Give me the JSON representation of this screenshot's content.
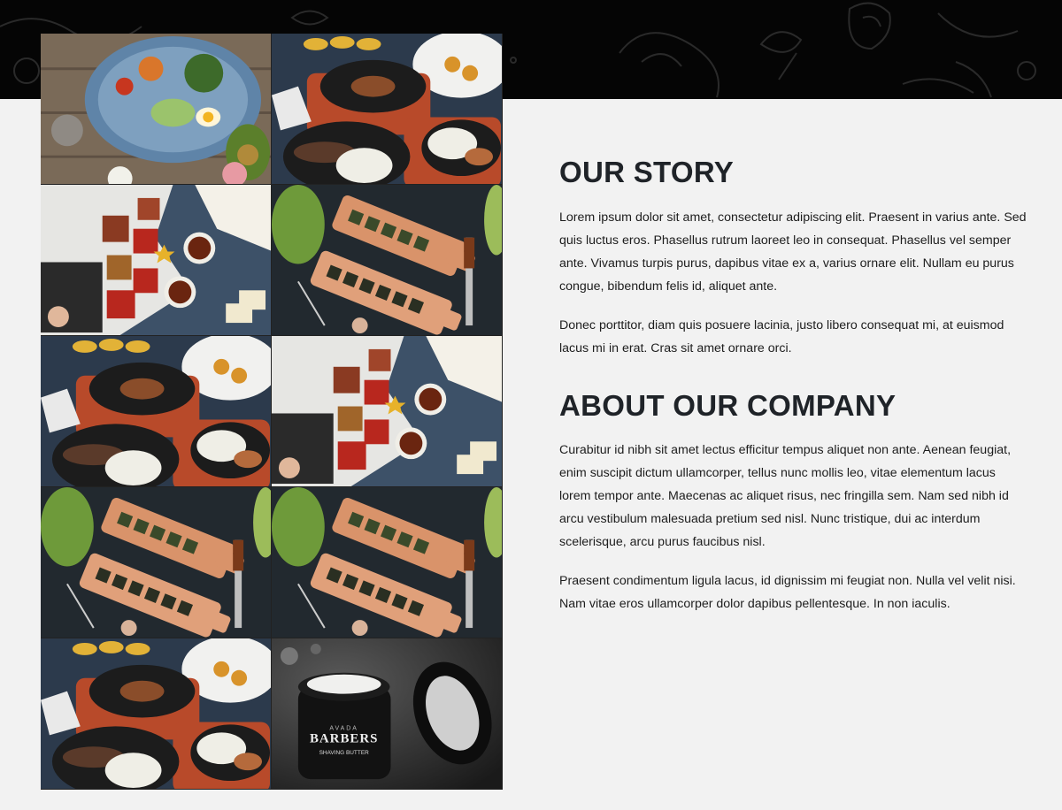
{
  "header": {
    "background_color": "#050505",
    "pattern": "food-doodle-pattern"
  },
  "gallery": {
    "tiles": [
      {
        "subject": "salad-bowl-photo"
      },
      {
        "subject": "sizzling-plates-photo"
      },
      {
        "subject": "breakfast-tea-photo"
      },
      {
        "subject": "sushi-boards-photo"
      },
      {
        "subject": "sizzling-plates-photo"
      },
      {
        "subject": "breakfast-tea-photo"
      },
      {
        "subject": "sushi-boards-photo"
      },
      {
        "subject": "sushi-boards-photo"
      },
      {
        "subject": "sizzling-plates-photo"
      },
      {
        "subject": "shaving-butter-jar-photo"
      }
    ],
    "product_label": {
      "brand_small": "AVADA",
      "brand": "BARBERS",
      "product": "SHAVING BUTTER"
    }
  },
  "story": {
    "title": "OUR STORY",
    "paragraphs": [
      "Lorem ipsum dolor sit amet, consectetur adipiscing elit. Praesent in varius ante. Sed quis luctus eros. Phasellus rutrum laoreet leo in consequat. Phasellus vel semper ante. Vivamus turpis purus, dapibus vitae ex a, varius ornare elit. Nullam eu purus congue, bibendum felis id, aliquet ante.",
      "Donec porttitor, diam quis posuere lacinia, justo libero consequat mi, at euismod lacus mi in erat. Cras sit amet ornare orci."
    ]
  },
  "company": {
    "title": "ABOUT OUR COMPANY",
    "paragraphs": [
      "Curabitur id nibh sit amet lectus efficitur tempus aliquet non ante. Aenean feugiat, enim suscipit dictum ullamcorper, tellus nunc mollis leo, vitae elementum lacus lorem tempor ante. Maecenas ac aliquet risus, nec fringilla sem. Nam sed nibh id arcu vestibulum malesuada pretium sed nisl. Nunc tristique, dui ac interdum scelerisque, arcu purus faucibus nisl.",
      "Praesent condimentum ligula lacus, id dignissim mi feugiat non. Nulla vel velit nisi. Nam vitae eros ullamcorper dolor dapibus pellentesque. In non iaculis."
    ]
  }
}
